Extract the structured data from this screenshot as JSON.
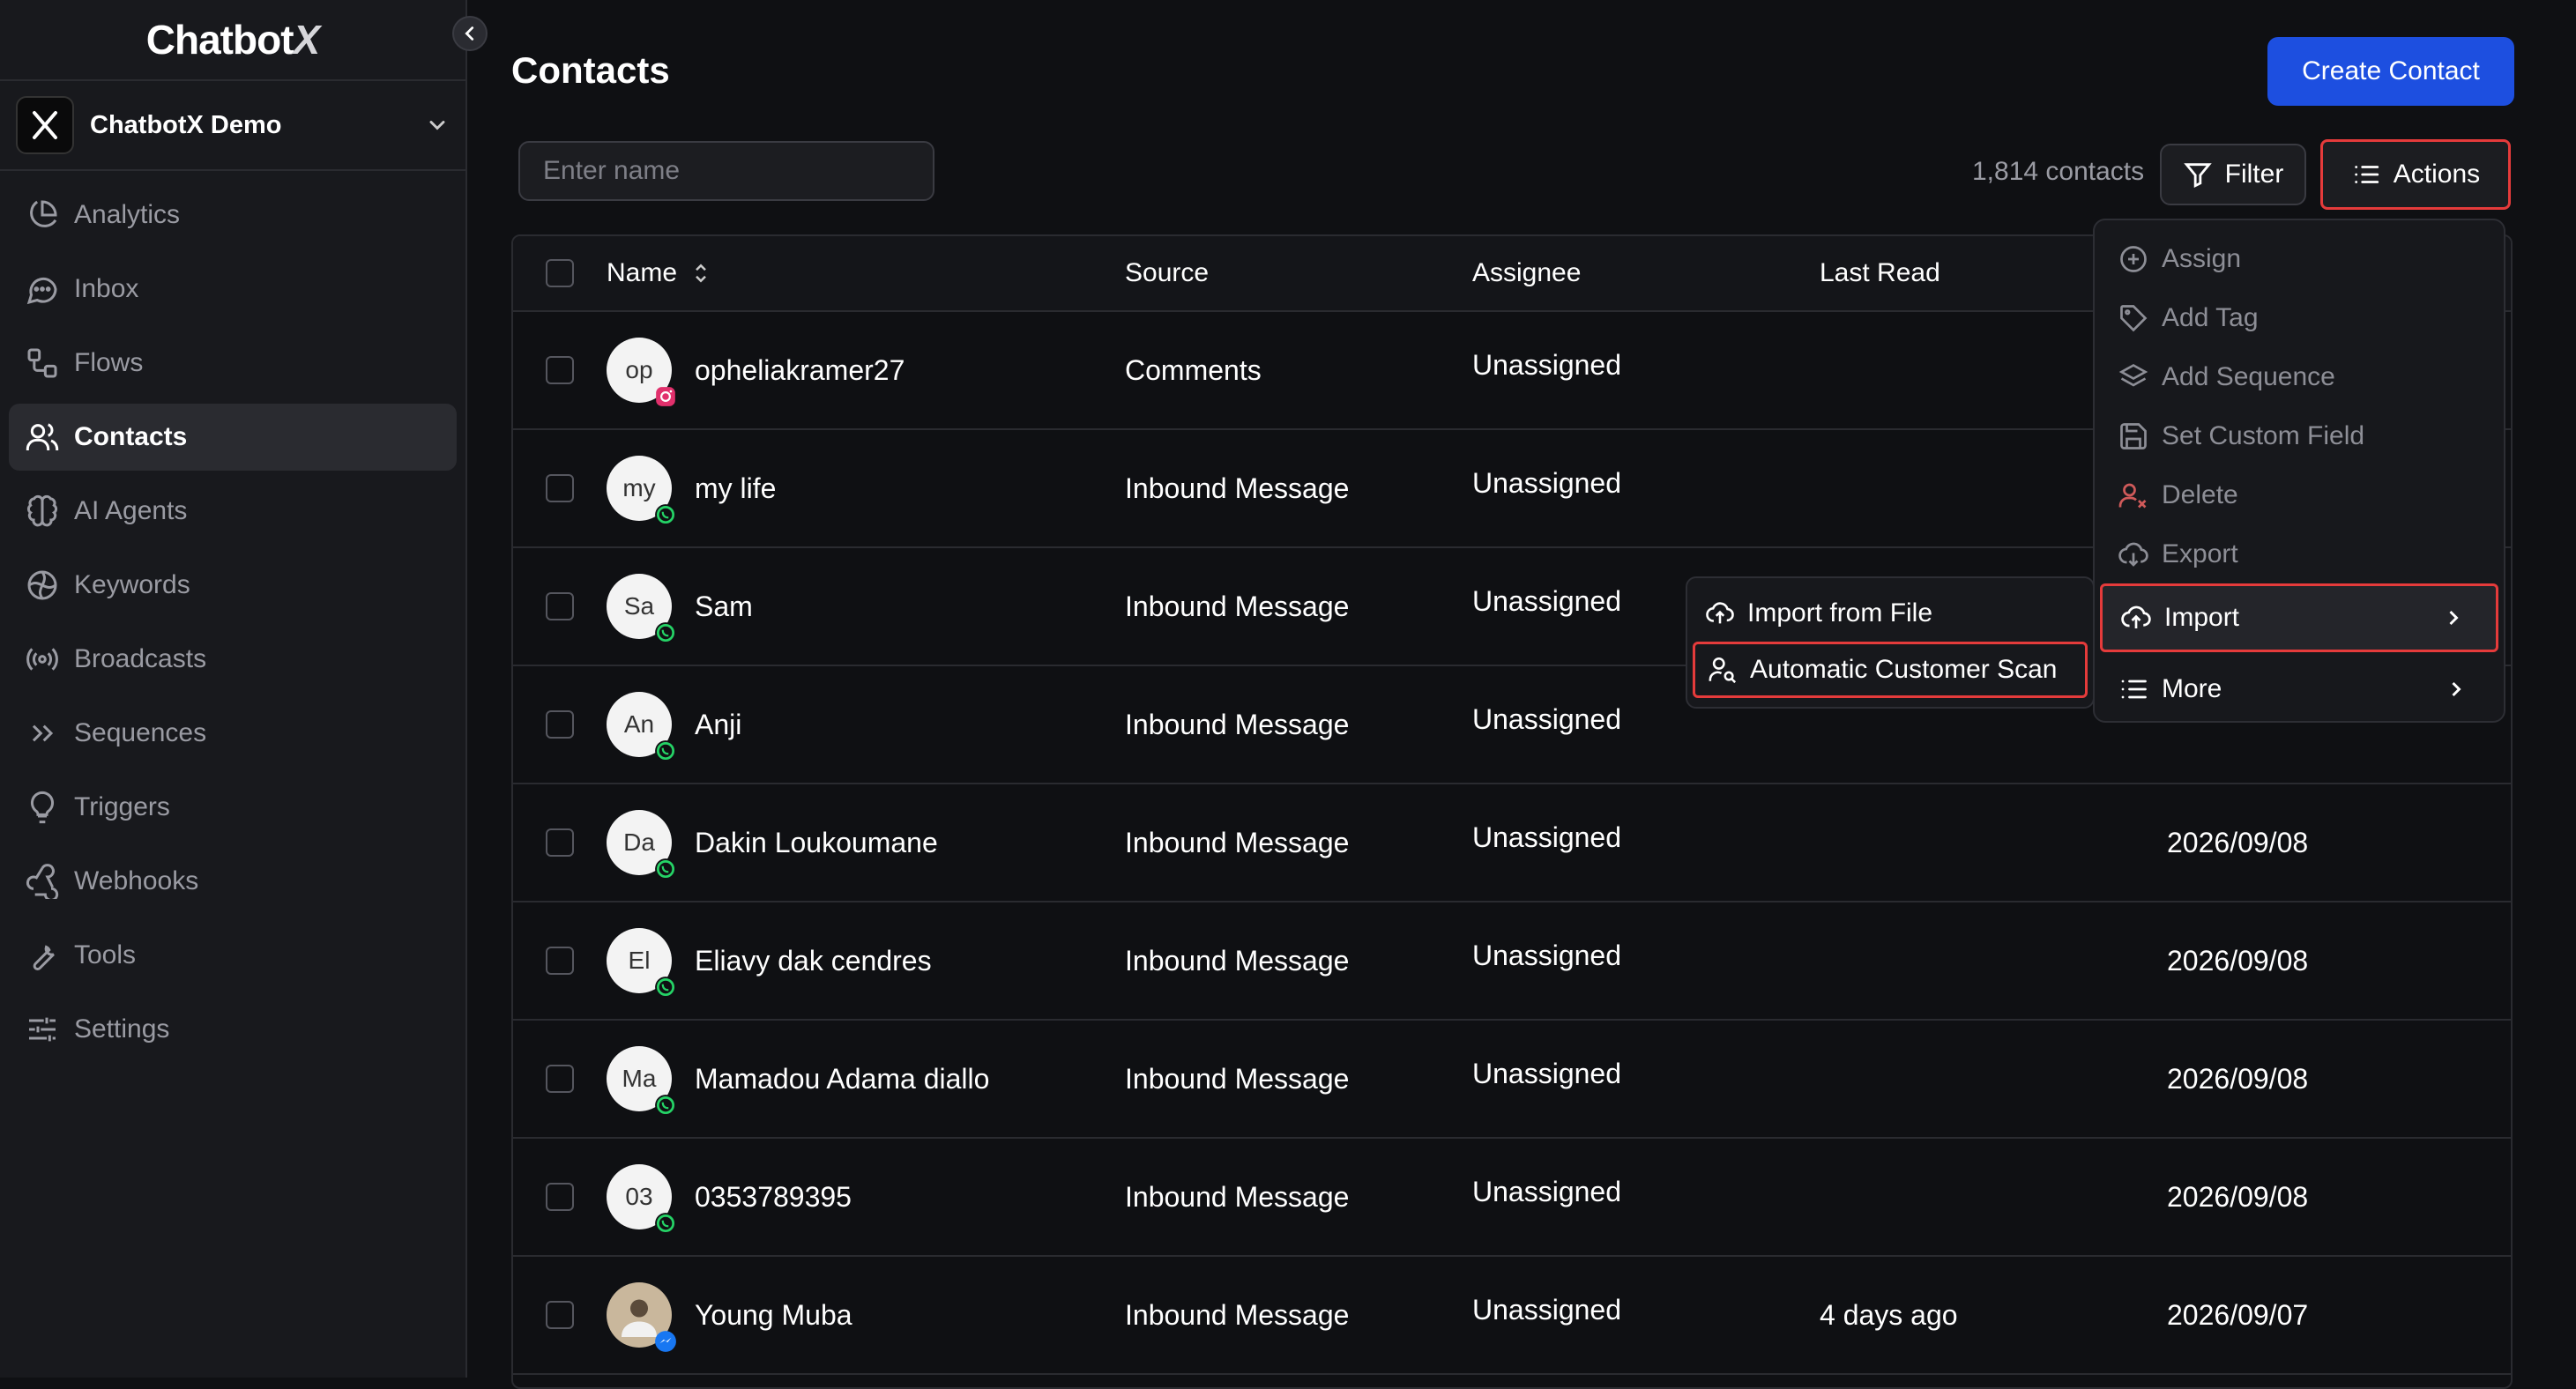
{
  "app": {
    "brand_main": "Chatbot",
    "brand_x": "X"
  },
  "workspace": {
    "name": "ChatbotX Demo"
  },
  "sidebar": {
    "items": [
      {
        "label": "Analytics",
        "icon": "pie-chart-icon"
      },
      {
        "label": "Inbox",
        "icon": "chat-bubble-icon"
      },
      {
        "label": "Flows",
        "icon": "flow-icon"
      },
      {
        "label": "Contacts",
        "icon": "users-icon"
      },
      {
        "label": "AI Agents",
        "icon": "brain-icon"
      },
      {
        "label": "Keywords",
        "icon": "keyword-icon"
      },
      {
        "label": "Broadcasts",
        "icon": "broadcast-icon"
      },
      {
        "label": "Sequences",
        "icon": "chevrons-right-icon"
      },
      {
        "label": "Triggers",
        "icon": "lightbulb-icon"
      },
      {
        "label": "Webhooks",
        "icon": "webhook-icon"
      },
      {
        "label": "Tools",
        "icon": "wrench-icon"
      },
      {
        "label": "Settings",
        "icon": "sliders-icon"
      }
    ],
    "active_index": 3
  },
  "header": {
    "title": "Contacts",
    "create_label": "Create Contact"
  },
  "toolbar": {
    "search_placeholder": "Enter name",
    "count_text": "1,814 contacts",
    "filter_label": "Filter",
    "actions_label": "Actions"
  },
  "table": {
    "columns": {
      "name": "Name",
      "source": "Source",
      "assignee": "Assignee",
      "last_read": "Last Read"
    },
    "rows": [
      {
        "initials": "op",
        "name": "opheliakramer27",
        "source": "Comments",
        "assignee": "Unassigned",
        "last_read": "",
        "date": "",
        "channel": "instagram"
      },
      {
        "initials": "my",
        "name": "my life",
        "source": "Inbound Message",
        "assignee": "Unassigned",
        "last_read": "",
        "date": "",
        "channel": "whatsapp"
      },
      {
        "initials": "Sa",
        "name": "Sam",
        "source": "Inbound Message",
        "assignee": "Unassigned",
        "last_read": "",
        "date": "",
        "channel": "whatsapp"
      },
      {
        "initials": "An",
        "name": "Anji",
        "source": "Inbound Message",
        "assignee": "Unassigned",
        "last_read": "",
        "date": "",
        "channel": "whatsapp"
      },
      {
        "initials": "Da",
        "name": "Dakin Loukoumane",
        "source": "Inbound Message",
        "assignee": "Unassigned",
        "last_read": "",
        "date": "2026/09/08",
        "channel": "whatsapp"
      },
      {
        "initials": "El",
        "name": "Eliavy dak cendres",
        "source": "Inbound Message",
        "assignee": "Unassigned",
        "last_read": "",
        "date": "2026/09/08",
        "channel": "whatsapp"
      },
      {
        "initials": "Ma",
        "name": "Mamadou Adama diallo",
        "source": "Inbound Message",
        "assignee": "Unassigned",
        "last_read": "",
        "date": "2026/09/08",
        "channel": "whatsapp"
      },
      {
        "initials": "03",
        "name": "0353789395",
        "source": "Inbound Message",
        "assignee": "Unassigned",
        "last_read": "",
        "date": "2026/09/08",
        "channel": "whatsapp"
      },
      {
        "initials": "",
        "name": "Young Muba",
        "source": "Inbound Message",
        "assignee": "Unassigned",
        "last_read": "4 days ago",
        "date": "2026/09/07",
        "channel": "messenger"
      }
    ]
  },
  "actions_menu": {
    "items": [
      {
        "label": "Assign",
        "icon": "plus-circle-icon",
        "enabled": false
      },
      {
        "label": "Add Tag",
        "icon": "tag-icon",
        "enabled": false
      },
      {
        "label": "Add Sequence",
        "icon": "layers-icon",
        "enabled": false
      },
      {
        "label": "Set Custom Field",
        "icon": "save-icon",
        "enabled": false
      },
      {
        "label": "Delete",
        "icon": "user-x-icon",
        "enabled": false
      },
      {
        "label": "Export",
        "icon": "cloud-download-icon",
        "enabled": false
      },
      {
        "label": "Import",
        "icon": "cloud-upload-icon",
        "enabled": true
      },
      {
        "label": "More",
        "icon": "list-icon",
        "enabled": true
      }
    ]
  },
  "import_submenu": {
    "items": [
      {
        "label": "Import from File",
        "icon": "cloud-upload-icon"
      },
      {
        "label": "Automatic Customer Scan",
        "icon": "user-search-icon"
      }
    ]
  },
  "colors": {
    "accent": "#1d4fe0",
    "highlight": "#e53b3b",
    "whatsapp": "#25d366",
    "instagram": "#e1306c",
    "messenger": "#1877f2"
  }
}
